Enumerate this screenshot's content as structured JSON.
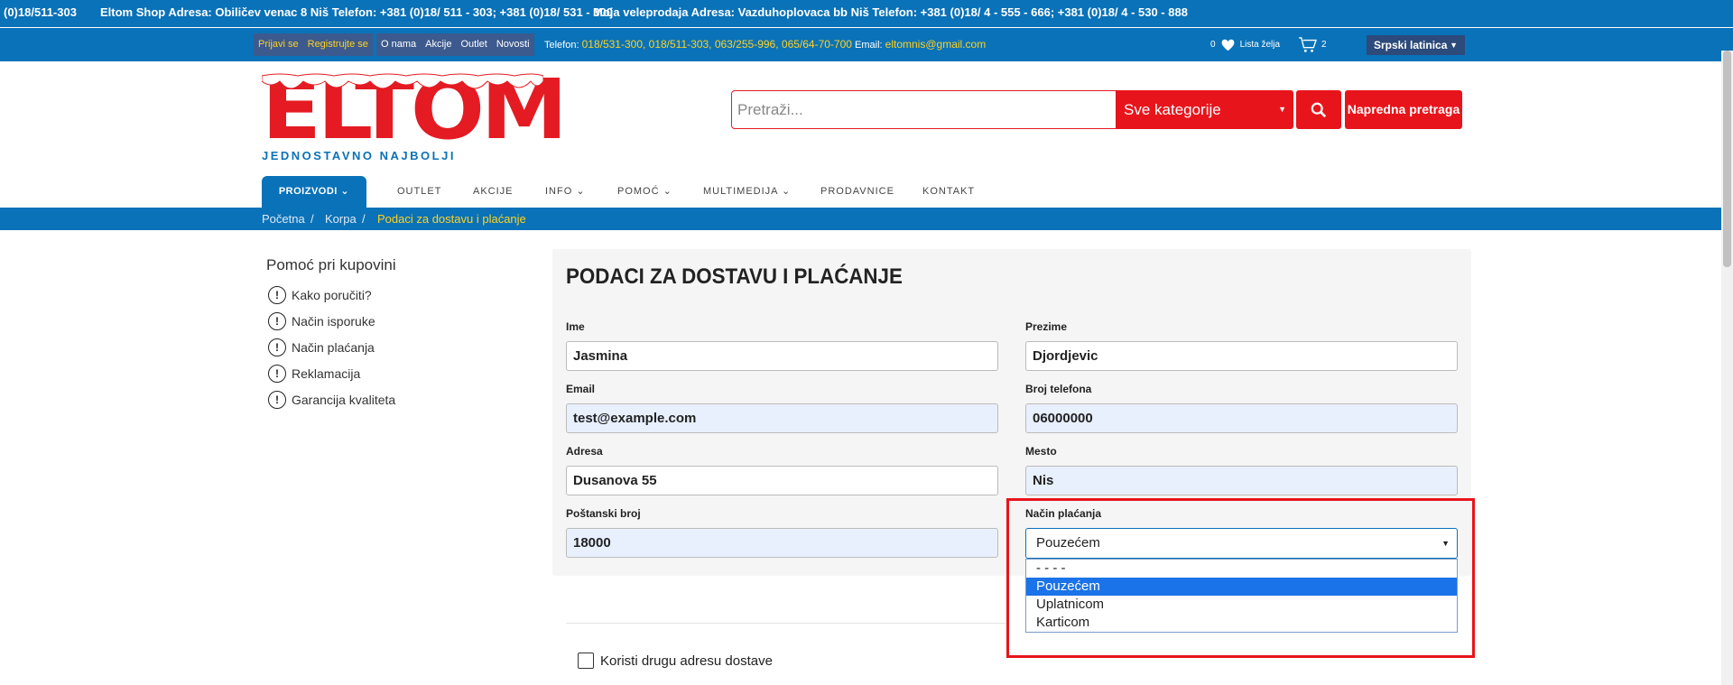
{
  "marquee": {
    "item1": "(0)18/511-303",
    "item2": "Eltom Shop Adresa: Obiličev venac 8 Niš Telefon: +381 (0)18/ 511 - 303; +381 (0)18/ 531 - 300",
    "item3": "Moja veleprodaja Adresa: Vazduhoplovaca bb Niš Telefon: +381 (0)18/ 4 - 555 - 666; +381 (0)18/ 4 - 530 - 888"
  },
  "topbar": {
    "login": "Prijavi se",
    "register": "Registrujte se",
    "links": [
      "O nama",
      "Akcije",
      "Outlet",
      "Novosti"
    ],
    "phone_label": "Telefon:",
    "phones": "018/531-300, 018/511-303, 063/255-996, 065/64-70-700",
    "email_label": "Email:",
    "email": "eltomnis@gmail.com",
    "wishlist_count": "0",
    "wishlist_label": "Lista želja",
    "cart_count": "2",
    "language": "Srpski latinica"
  },
  "logo": {
    "name": "ELTOM",
    "tagline": "JEDNOSTAVNO NAJBOLJI"
  },
  "search": {
    "placeholder": "Pretraži...",
    "category": "Sve kategorije",
    "advanced": "Napredna pretraga"
  },
  "nav": {
    "products": "PROIZVODI",
    "items": [
      "OUTLET",
      "AKCIJE",
      "INFO",
      "POMOĆ",
      "MULTIMEDIJA",
      "PRODAVNICE",
      "KONTAKT"
    ]
  },
  "breadcrumb": {
    "home": "Početna",
    "cart": "Korpa",
    "current": "Podaci za dostavu i plaćanje",
    "sep": "/"
  },
  "help": {
    "title": "Pomoć pri kupovini",
    "items": [
      "Kako poručiti?",
      "Način isporuke",
      "Način plaćanja",
      "Reklamacija",
      "Garancija kvaliteta"
    ]
  },
  "form": {
    "title": "PODACI ZA DOSTAVU I PLAĆANJE",
    "first_name_label": "Ime",
    "first_name": "Jasmina",
    "last_name_label": "Prezime",
    "last_name": "Djordjevic",
    "email_label": "Email",
    "email": "test@example.com",
    "phone_label": "Broj telefona",
    "phone": "06000000",
    "address_label": "Adresa",
    "address": "Dusanova 55",
    "city_label": "Mesto",
    "city": "Nis",
    "zip_label": "Poštanski broj",
    "zip": "18000",
    "payment_label": "Način plaćanja",
    "payment_selected": "Pouzećem",
    "payment_options": [
      "- - - -",
      "Pouzećem",
      "Uplatnicom",
      "Karticom"
    ],
    "alt_address": "Koristi drugu adresu dostave"
  }
}
